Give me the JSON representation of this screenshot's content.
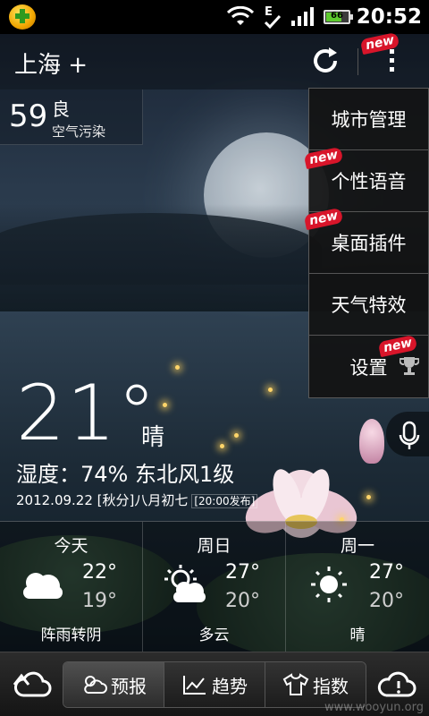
{
  "status_bar": {
    "time": "20:52",
    "battery_level": "66",
    "network": "E",
    "icons": [
      "app-360-icon",
      "wifi-icon",
      "edge-network-icon",
      "signal-icon",
      "battery-icon"
    ]
  },
  "header": {
    "city": "上海 +",
    "new_badge": "new"
  },
  "aqi": {
    "value": "59",
    "level": "良",
    "label": "空气污染"
  },
  "menu": {
    "items": [
      {
        "label": "城市管理",
        "new": ""
      },
      {
        "label": "个性语音",
        "new": "new"
      },
      {
        "label": "桌面插件",
        "new": "new"
      },
      {
        "label": "天气特效",
        "new": ""
      },
      {
        "label": "设置",
        "new": "new"
      }
    ]
  },
  "current": {
    "temperature": "21°",
    "condition": "晴",
    "humidity_wind": "湿度：74%  东北风1级",
    "date": "2012.09.22  [秋分]八月初七",
    "published": "[20:00发布]"
  },
  "forecast": [
    {
      "day": "今天",
      "high": "22°",
      "low": "19°",
      "desc": "阵雨转阴",
      "icon": "cloudy-icon"
    },
    {
      "day": "周日",
      "high": "27°",
      "low": "20°",
      "desc": "多云",
      "icon": "partly-cloudy-icon"
    },
    {
      "day": "周一",
      "high": "27°",
      "low": "20°",
      "desc": "晴",
      "icon": "sunny-icon"
    }
  ],
  "toolbar": {
    "tabs": [
      {
        "label": "预报",
        "icon": "weather-forecast-icon",
        "active": true
      },
      {
        "label": "趋势",
        "icon": "trend-chart-icon",
        "active": false
      },
      {
        "label": "指数",
        "icon": "shirt-icon",
        "active": false
      }
    ]
  },
  "watermark": "www.wooyun.org",
  "colors": {
    "new_badge": "#d8152a",
    "menu_bg": "#121212",
    "battery_fill": "#5ecb2f"
  }
}
